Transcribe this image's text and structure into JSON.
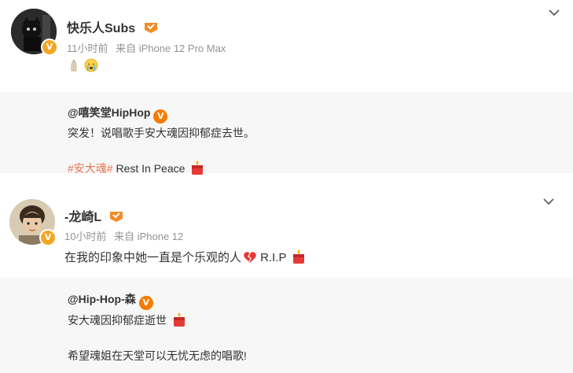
{
  "posts": [
    {
      "username": "快乐人Subs",
      "time": "11小时前",
      "source": "来自 iPhone 12 Pro Max",
      "content_icons": [
        "pray-emoji-icon",
        "crying-emoji-icon"
      ],
      "repost": {
        "user": "@嘻笑堂HipHop",
        "line1": "突发！说唱歌手安大魂因抑郁症去世。",
        "hashtag": "#安大魂#",
        "line2_tail": " Rest In Peace"
      }
    },
    {
      "username": "-龙崎L",
      "time": "10小时前",
      "source": "来自 iPhone 12",
      "content": "在我的印象中她一直是个乐观的人",
      "content_tail": " R.I.P",
      "repost": {
        "user": "@Hip-Hop-森",
        "line1": "安大魂因抑郁症逝世",
        "line2": "希望魂姐在天堂可以无忧无虑的唱歌!"
      }
    }
  ],
  "colors": {
    "hashtag": "#eb7350",
    "meta": "#939393",
    "repost_bg": "#f7f7f7",
    "verified": "#f5a623"
  }
}
